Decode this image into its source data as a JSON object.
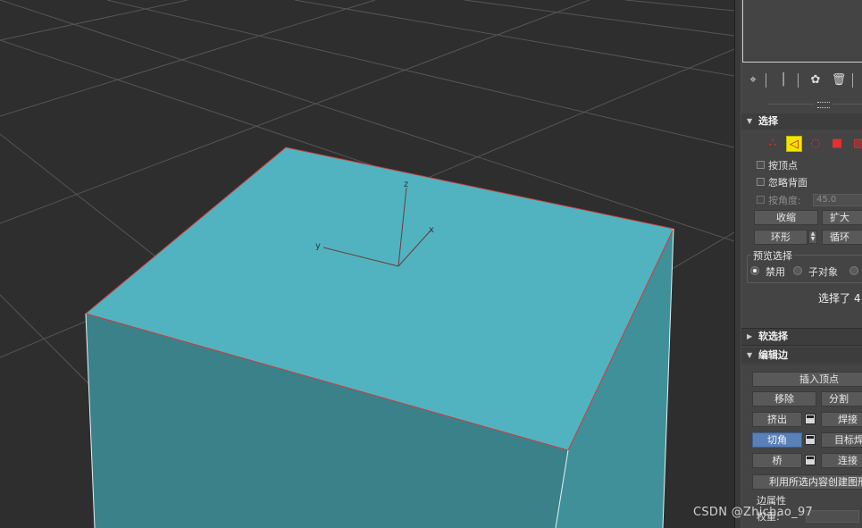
{
  "viewport": {
    "axis_labels": {
      "z": "z",
      "x": "x",
      "y": "y"
    },
    "colors": {
      "top_face": "#52b3c0",
      "front_face": "#3b8189",
      "right_face": "#3f9099",
      "edge_selected": "#d13b3b",
      "grid_bg": "#2e2e2e"
    }
  },
  "toolbar": {
    "icons": [
      "pin-icon",
      "modifier-stack-icon",
      "make-unique-icon",
      "trash-icon"
    ]
  },
  "selection": {
    "header": "选择",
    "modes": [
      "vertex-icon",
      "edge-icon",
      "border-icon",
      "polygon-icon",
      "element-icon"
    ],
    "active_mode": "edge-icon",
    "by_vertex": "按顶点",
    "ignore_backfacing": "忽略背面",
    "by_angle": "按角度:",
    "angle_value": "45.0",
    "shrink": "收缩",
    "grow": "扩大",
    "ring": "环形",
    "loop": "循环",
    "preview_title": "预览选择",
    "preview_off": "禁用",
    "preview_subobject": "子对象",
    "status": "选择了 4"
  },
  "soft_selection": {
    "header": "软选择"
  },
  "edit_edges": {
    "header": "编辑边",
    "insert_vertex": "插入顶点",
    "remove": "移除",
    "split": "分割",
    "extrude": "挤出",
    "weld": "焊接",
    "chamfer": "切角",
    "target_weld": "目标焊",
    "bridge": "桥",
    "connect": "连接",
    "create_shape": "利用所选内容创建图形",
    "edge_props": "边属性",
    "weight_label": "权重:"
  },
  "watermark": "CSDN @Zhichao_97"
}
